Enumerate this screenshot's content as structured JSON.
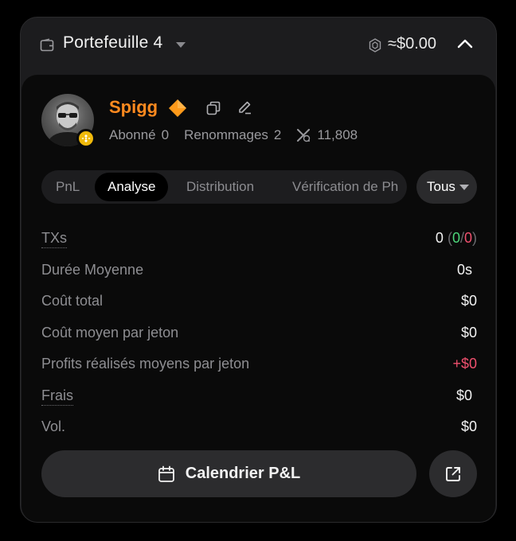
{
  "header": {
    "wallet_title": "Portefeuille 4",
    "balance": "≈$0.00"
  },
  "profile": {
    "username": "Spigg",
    "stats": {
      "followers_label": "Abonné",
      "followers_value": "0",
      "renames_label": "Renommages",
      "renames_value": "2",
      "x_followers_value": "11,808"
    }
  },
  "tabs": [
    {
      "label": "PnL",
      "active": false
    },
    {
      "label": "Analyse",
      "active": true
    },
    {
      "label": "Distribution",
      "active": false
    },
    {
      "label": "Vérification de Ph",
      "active": false
    }
  ],
  "filter": {
    "selected": "Tous"
  },
  "metrics": [
    {
      "label": "TXs",
      "value_main": "0",
      "value_open": "(",
      "value_buys": "0",
      "value_sep": "/",
      "value_sells": "0",
      "value_close": ")"
    },
    {
      "label": "Durée Moyenne",
      "value": "0s"
    },
    {
      "label": "Coût total",
      "value": "$0"
    },
    {
      "label": "Coût moyen par jeton",
      "value": "$0"
    },
    {
      "label": "Profits réalisés moyens par jeton",
      "value": "+$0"
    },
    {
      "label": "Frais",
      "value": "$0"
    },
    {
      "label": "Vol.",
      "value": "$0"
    }
  ],
  "actions": {
    "calendar_label": "Calendrier P&L"
  },
  "colors": {
    "accent_orange": "#ff8a1f",
    "positive_green": "#4cd67a",
    "negative_pink": "#f0506e",
    "bnb_yellow": "#f0b90b"
  }
}
